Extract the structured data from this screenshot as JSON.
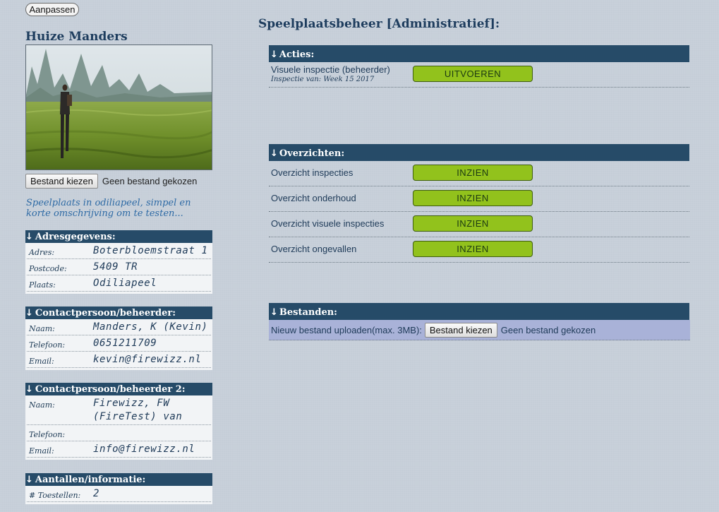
{
  "edit_button": "Aanpassen",
  "place": {
    "title": "Huize Manders",
    "file_button": "Bestand kiezen",
    "file_status": "Geen bestand gekozen",
    "description": "Speelplaats in odiliapeel, simpel en korte omschrijving om te testen..."
  },
  "sections": {
    "address": {
      "title": "Adresgegevens:",
      "rows": [
        {
          "key": "Adres:",
          "value": "Boterbloemstraat 1"
        },
        {
          "key": "Postcode:",
          "value": "5409 TR"
        },
        {
          "key": "Plaats:",
          "value": "Odiliapeel"
        }
      ]
    },
    "contact1": {
      "title": "Contactpersoon/beheerder:",
      "rows": [
        {
          "key": "Naam:",
          "value": "Manders, K (Kevin)"
        },
        {
          "key": "Telefoon:",
          "value": "0651211709"
        },
        {
          "key": "Email:",
          "value": "kevin@firewizz.nl"
        }
      ]
    },
    "contact2": {
      "title": "Contactpersoon/beheerder 2:",
      "rows": [
        {
          "key": "Naam:",
          "value": "Firewizz, FW (FireTest) van"
        },
        {
          "key": "Telefoon:",
          "value": ""
        },
        {
          "key": "Email:",
          "value": "info@firewizz.nl"
        }
      ]
    },
    "counts": {
      "title": "Aantallen/informatie:",
      "rows": [
        {
          "key": "# Toestellen:",
          "value": "2"
        }
      ]
    }
  },
  "main": {
    "title": "Speelplaatsbeheer [Administratief]:",
    "arrow": "↓",
    "actions": {
      "title": "Acties:",
      "rows": [
        {
          "label": "Visuele inspectie (beheerder)",
          "sub": "Inspectie van: Week 15 2017",
          "button": "UITVOEREN"
        }
      ]
    },
    "overviews": {
      "title": "Overzichten:",
      "rows": [
        {
          "label": "Overzicht inspecties",
          "button": "INZIEN"
        },
        {
          "label": "Overzicht onderhoud",
          "button": "INZIEN"
        },
        {
          "label": "Overzicht visuele inspecties",
          "button": "INZIEN"
        },
        {
          "label": "Overzicht ongevallen",
          "button": "INZIEN"
        }
      ]
    },
    "files": {
      "title": "Bestanden:",
      "upload_label": "Nieuw bestand uploaden(max. 3MB):",
      "file_button": "Bestand kiezen",
      "file_status": "Geen bestand gekozen"
    }
  },
  "colors": {
    "header_bg": "#264b68",
    "button_green": "#92c21c",
    "upload_bg": "#a9b2d8",
    "description_text": "#2e6aa5"
  }
}
